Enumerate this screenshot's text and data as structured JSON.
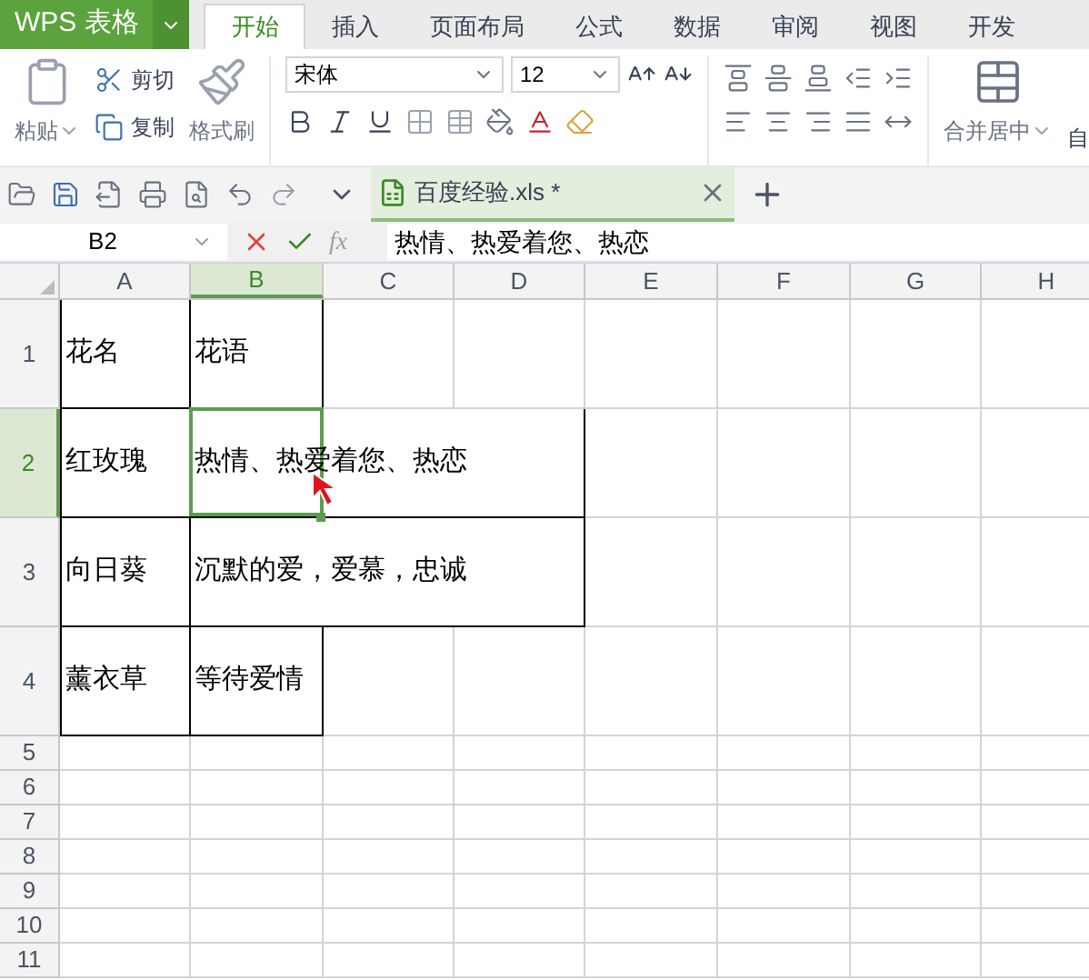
{
  "app_menu": {
    "label": "WPS 表格"
  },
  "tabs": [
    {
      "label": "开始",
      "selected": true
    },
    {
      "label": "插入",
      "selected": false
    },
    {
      "label": "页面布局",
      "selected": false
    },
    {
      "label": "公式",
      "selected": false
    },
    {
      "label": "数据",
      "selected": false
    },
    {
      "label": "审阅",
      "selected": false
    },
    {
      "label": "视图",
      "selected": false
    },
    {
      "label": "开发",
      "selected": false
    }
  ],
  "ribbon": {
    "paste": "粘贴",
    "cut": "剪切",
    "copy": "复制",
    "format_painter": "格式刷",
    "font": "宋体",
    "font_size": "12",
    "merge": "合并居中",
    "wrap": "自"
  },
  "document_tab": {
    "title": "百度经验.xls *"
  },
  "formula_bar": {
    "cell": "B2",
    "function_label": "fx",
    "formula": "热情、热爱着您、热恋"
  },
  "columns": [
    {
      "label": "A",
      "selected": false
    },
    {
      "label": "B",
      "selected": true
    },
    {
      "label": "C",
      "selected": false
    },
    {
      "label": "D",
      "selected": false
    },
    {
      "label": "E",
      "selected": false
    },
    {
      "label": "F",
      "selected": false
    },
    {
      "label": "G",
      "selected": false
    },
    {
      "label": "H",
      "selected": false
    }
  ],
  "rows": [
    {
      "label": "1",
      "selected": false,
      "cells": [
        {
          "text": "花名",
          "selected": false
        },
        {
          "text": "花语",
          "selected": false
        }
      ]
    },
    {
      "label": "2",
      "selected": true,
      "cells": [
        {
          "text": "红玫瑰",
          "selected": false
        },
        {
          "text": "热情、热爱着您、热恋",
          "selected": true
        }
      ]
    },
    {
      "label": "3",
      "selected": false,
      "cells": [
        {
          "text": "向日葵",
          "selected": false
        },
        {
          "text": "沉默的爱，爱慕，忠诚",
          "selected": false
        }
      ]
    },
    {
      "label": "4",
      "selected": false,
      "cells": [
        {
          "text": "薰衣草",
          "selected": false
        },
        {
          "text": "等待爱情",
          "selected": false
        }
      ]
    },
    {
      "label": "5",
      "selected": false
    },
    {
      "label": "6",
      "selected": false
    },
    {
      "label": "7",
      "selected": false
    },
    {
      "label": "8",
      "selected": false
    },
    {
      "label": "9",
      "selected": false
    },
    {
      "label": "10",
      "selected": false
    },
    {
      "label": "11",
      "selected": false
    }
  ]
}
